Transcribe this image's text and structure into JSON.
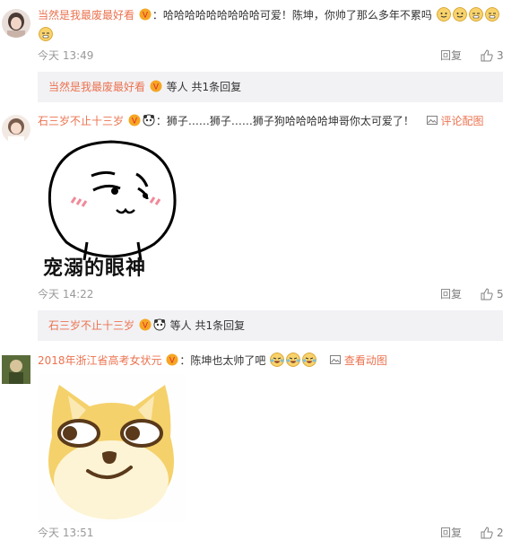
{
  "comments": [
    {
      "user": "当然是我最废最好看",
      "colon": "：",
      "text": "哈哈哈哈哈哈哈哈哈可爱！陈坤，你帅了那么多年不累吗",
      "time": "今天 13:49",
      "reply_label": "回复",
      "like_count": "3",
      "sub_user": "当然是我最废最好看",
      "sub_text": "等人 共1条回复"
    },
    {
      "user": "石三岁不止十三岁",
      "colon": "：",
      "text": "狮子……狮子……狮子狗哈哈哈哈坤哥你太可爱了！",
      "pic_link": "评论配图",
      "image_caption": "宠溺的眼神",
      "time": "今天 14:22",
      "reply_label": "回复",
      "like_count": "5",
      "sub_user": "石三岁不止十三岁",
      "sub_text": "等人 共1条回复"
    },
    {
      "user": "2018年浙江省高考女状元",
      "colon": "：",
      "text": "陈坤也太帅了吧",
      "gif_link": "查看动图",
      "time": "今天 13:51",
      "reply_label": "回复",
      "like_count": "2"
    }
  ],
  "colors": {
    "username": "#eb7350",
    "sub_bg": "#f2f2f5",
    "meta": "#999999"
  },
  "icons": [
    "vip-badge-icon",
    "emoji-face-icon",
    "panda-badge-icon",
    "picture-icon",
    "thumb-up-icon",
    "laughing-tears-icon"
  ]
}
